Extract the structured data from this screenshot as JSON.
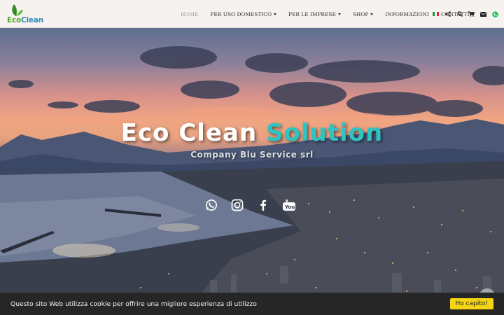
{
  "brand": {
    "logo_eco": "Eco",
    "logo_clean": "Clean",
    "green": "#4ea52e",
    "blue": "#2a8bb3"
  },
  "nav": {
    "items": [
      {
        "label": "HOME",
        "active": true,
        "dropdown": false
      },
      {
        "label": "PER USO DOMESTICO",
        "active": false,
        "dropdown": true
      },
      {
        "label": "PER LE IMPRESE",
        "active": false,
        "dropdown": true
      },
      {
        "label": "SHOP",
        "active": false,
        "dropdown": true
      },
      {
        "label": "INFORMAZIONI",
        "active": false,
        "dropdown": false
      },
      {
        "label": "CONTATTI",
        "active": false,
        "dropdown": false
      }
    ],
    "icons": [
      "italian-flag-icon",
      "share-icon",
      "search-icon",
      "cart-icon",
      "mail-icon",
      "whatsapp-icon"
    ]
  },
  "hero": {
    "title_white": "Eco Clean",
    "title_accent": "Solution",
    "accent_color": "#2ec4c4",
    "subtitle": "Company Blu Service srl",
    "socials": [
      "whatsapp-icon",
      "instagram-icon",
      "facebook-icon",
      "youtube-icon"
    ]
  },
  "cookie": {
    "text": "Questo sito Web utilizza cookie per offrire una migliore esperienza di utilizzo",
    "button": "Ho capito!",
    "button_color": "#f5d413"
  }
}
